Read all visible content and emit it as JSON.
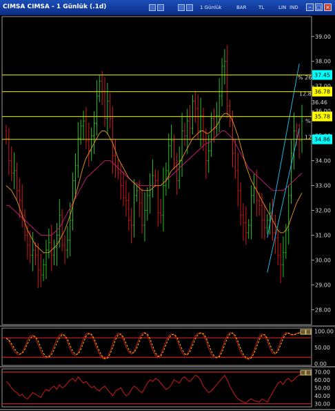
{
  "window": {
    "title": "CIMSA CIMSA - 1 Günlük (.1d)",
    "toolbar_words": [
      "1 Günlük",
      "BAR",
      "TL",
      "LIN",
      "IND"
    ]
  },
  "colors": {
    "background": "#000000",
    "up_bar": "#22c322",
    "down_bar": "#d11a1a",
    "ma_fast": "#d98a1e",
    "ma_slow": "#c21a73",
    "horizontal_level": "#c8c800",
    "trend_channel": "#1fb7e6",
    "oscillator_line": "#d01818",
    "oscillator_signal": "#f2c200",
    "oscillator_band": "#cc2222"
  },
  "chart_data": [
    {
      "type": "candlestick",
      "title": "",
      "ylim": [
        27.4,
        39.8
      ],
      "y_ticks": [
        "39.00",
        "38.00",
        "37.00",
        "36.00",
        "35.00",
        "34.00",
        "33.00",
        "32.00",
        "31.00",
        "30.00",
        "29.00",
        "28.00"
      ],
      "horizontal_levels": [
        {
          "value": 37.45,
          "label": "37.45",
          "label_bg": "#00ffff"
        },
        {
          "value": 36.78,
          "label": "36.78",
          "label_bg": "#ffff00"
        },
        {
          "value": 35.78,
          "label": "35.78",
          "label_bg": "#ffff00"
        },
        {
          "value": 34.86,
          "label": "34.86",
          "label_bg": "#00ffff"
        }
      ],
      "background_labels": [
        "% 26",
        "12.8",
        "36.46",
        "%",
        "12"
      ],
      "series": [
        {
          "name": "",
          "kind": "close",
          "values": [
            34.9,
            34.0,
            33.5,
            33.6,
            32.8,
            32.4,
            31.8,
            31.0,
            30.6,
            30.2,
            30.4,
            30.2,
            29.6,
            29.4,
            29.8,
            30.4,
            30.7,
            30.2,
            30.5,
            31.0,
            31.8,
            30.6,
            30.4,
            30.8,
            31.6,
            33.2,
            33.8,
            34.9,
            35.4,
            35.6,
            34.8,
            34.4,
            35.0,
            35.5,
            36.6,
            37.2,
            36.8,
            35.7,
            36.4,
            35.7,
            34.2,
            33.8,
            33.5,
            33.0,
            32.5,
            32.4,
            31.6,
            31.4,
            32.6,
            32.8,
            32.3,
            31.4,
            32.0,
            32.6,
            33.0,
            33.4,
            33.2,
            31.9,
            31.8,
            33.0,
            33.6,
            34.6,
            34.8,
            33.9,
            33.2,
            34.0,
            35.2,
            35.0,
            35.6,
            35.3,
            36.4,
            36.1,
            35.2,
            35.8,
            34.8,
            34.0,
            34.4,
            35.7,
            35.3,
            35.8,
            36.6,
            37.8,
            38.0,
            36.2,
            35.6,
            34.3,
            33.6,
            32.8,
            31.8,
            31.5,
            31.1,
            31.4,
            32.6,
            32.9,
            32.4,
            32.2,
            31.6,
            31.3,
            31.6,
            31.9,
            31.1,
            30.9,
            30.2,
            29.8,
            30.3,
            31.2,
            32.6,
            34.3,
            35.2,
            35.0,
            34.8,
            35.6
          ]
        },
        {
          "name": "",
          "kind": "moving_average_fast",
          "values": [
            33.0,
            32.9,
            32.8,
            32.6,
            32.4,
            32.1,
            31.8,
            31.5,
            31.2,
            31.0,
            30.8,
            30.6,
            30.5,
            30.4,
            30.3,
            30.3,
            30.3,
            30.4,
            30.5,
            30.6,
            30.8,
            31.0,
            31.2,
            31.5,
            31.8,
            32.2,
            32.6,
            33.0,
            33.4,
            33.8,
            34.1,
            34.3,
            34.5,
            34.7,
            34.9,
            35.1,
            35.2,
            35.2,
            35.1,
            34.9,
            34.7,
            34.4,
            34.1,
            33.9,
            33.7,
            33.5,
            33.3,
            33.2,
            33.1,
            33.0,
            32.9,
            32.8,
            32.8,
            32.8,
            32.8,
            32.9,
            33.0,
            33.0,
            33.0,
            33.1,
            33.2,
            33.4,
            33.6,
            33.7,
            33.8,
            33.9,
            34.1,
            34.3,
            34.5,
            34.7,
            34.9,
            35.0,
            35.1,
            35.2,
            35.2,
            35.1,
            35.1,
            35.2,
            35.3,
            35.4,
            35.6,
            35.8,
            35.9,
            35.9,
            35.8,
            35.6,
            35.3,
            35.0,
            34.6,
            34.2,
            33.8,
            33.5,
            33.2,
            33.0,
            32.8,
            32.6,
            32.4,
            32.2,
            32.0,
            31.8,
            31.6,
            31.4,
            31.2,
            31.1,
            31.1,
            31.2,
            31.4,
            31.7,
            32.0,
            32.3,
            32.5,
            32.7
          ]
        },
        {
          "name": "",
          "kind": "moving_average_slow",
          "values": [
            32.2,
            32.2,
            32.1,
            32.0,
            31.9,
            31.8,
            31.7,
            31.6,
            31.5,
            31.4,
            31.3,
            31.2,
            31.1,
            31.0,
            31.0,
            31.0,
            31.0,
            31.0,
            31.1,
            31.2,
            31.3,
            31.5,
            31.7,
            31.9,
            32.1,
            32.3,
            32.5,
            32.7,
            32.9,
            33.1,
            33.3,
            33.4,
            33.5,
            33.6,
            33.7,
            33.8,
            33.9,
            34.0,
            34.0,
            34.0,
            33.9,
            33.8,
            33.7,
            33.6,
            33.5,
            33.4,
            33.3,
            33.2,
            33.1,
            33.1,
            33.0,
            33.0,
            33.0,
            33.0,
            33.0,
            33.0,
            33.0,
            33.0,
            33.0,
            33.1,
            33.2,
            33.3,
            33.4,
            33.5,
            33.6,
            33.7,
            33.8,
            33.9,
            34.0,
            34.1,
            34.2,
            34.3,
            34.4,
            34.5,
            34.6,
            34.7,
            34.7,
            34.8,
            34.9,
            35.0,
            35.1,
            35.2,
            35.2,
            35.1,
            35.0,
            34.9,
            34.7,
            34.5,
            34.3,
            34.1,
            33.9,
            33.7,
            33.6,
            33.5,
            33.4,
            33.3,
            33.2,
            33.1,
            33.0,
            32.9,
            32.8,
            32.8,
            32.8,
            32.8,
            32.8,
            32.9,
            33.0,
            33.1,
            33.2,
            33.3,
            33.4,
            33.5
          ]
        }
      ],
      "trend_channel": {
        "from_bar": 98,
        "to_bar": 110,
        "lower_start": 29.5,
        "upper_start": 30.9,
        "lower_end": 35.3,
        "upper_end": 37.9
      }
    },
    {
      "type": "line",
      "title": "",
      "ylim": [
        -5,
        110
      ],
      "y_ticks": [
        "100.00",
        "50.00",
        "0.00"
      ],
      "band_levels": [
        80,
        20
      ],
      "series": [
        {
          "name": "",
          "kind": "oscillator",
          "values": [
            82,
            70,
            55,
            40,
            30,
            28,
            35,
            52,
            72,
            86,
            88,
            80,
            60,
            38,
            24,
            18,
            22,
            35,
            55,
            75,
            88,
            92,
            85,
            68,
            45,
            30,
            26,
            34,
            54,
            78,
            92,
            95,
            88,
            70,
            48,
            30,
            18,
            14,
            20,
            38,
            62,
            84,
            94,
            90,
            74,
            52,
            36,
            30,
            38,
            58,
            80,
            94,
            96,
            88,
            66,
            42,
            26,
            20,
            28,
            48,
            70,
            86,
            92,
            90,
            76,
            54,
            36,
            26,
            30,
            46,
            68,
            86,
            94,
            96,
            90,
            72,
            48,
            30,
            20,
            18,
            26,
            46,
            70,
            88,
            96,
            94,
            80,
            58,
            36,
            22,
            16,
            14,
            22,
            40,
            64,
            84,
            92,
            88,
            70,
            48,
            32,
            30,
            46,
            70,
            88,
            96,
            94,
            88,
            90,
            94,
            96,
            97
          ]
        },
        {
          "name": "",
          "kind": "signal",
          "values": [
            78,
            74,
            62,
            48,
            36,
            30,
            32,
            44,
            62,
            78,
            86,
            84,
            70,
            50,
            32,
            22,
            21,
            28,
            44,
            64,
            80,
            90,
            88,
            76,
            56,
            38,
            29,
            30,
            44,
            66,
            85,
            93,
            91,
            78,
            58,
            38,
            24,
            16,
            17,
            30,
            50,
            74,
            89,
            92,
            82,
            63,
            44,
            33,
            34,
            48,
            69,
            87,
            95,
            92,
            77,
            54,
            34,
            23,
            24,
            38,
            59,
            78,
            89,
            91,
            83,
            65,
            45,
            31,
            28,
            38,
            57,
            77,
            90,
            95,
            93,
            81,
            60,
            39,
            25,
            19,
            22,
            36,
            58,
            79,
            92,
            95,
            87,
            69,
            47,
            29,
            19,
            15,
            18,
            31,
            52,
            74,
            88,
            90,
            79,
            59,
            40,
            31,
            38,
            58,
            79,
            92,
            95,
            91,
            89,
            92,
            95,
            96
          ]
        }
      ]
    },
    {
      "type": "line",
      "title": "",
      "ylim": [
        26,
        74
      ],
      "y_ticks": [
        "70.00",
        "60.00",
        "50.00",
        "40.00",
        "30.00"
      ],
      "band_levels": [
        70,
        30
      ],
      "series": [
        {
          "name": "",
          "kind": "rsi",
          "values": [
            58,
            55,
            50,
            46,
            44,
            40,
            42,
            38,
            36,
            40,
            44,
            42,
            40,
            38,
            44,
            48,
            46,
            50,
            52,
            48,
            54,
            50,
            52,
            56,
            60,
            62,
            58,
            64,
            60,
            56,
            58,
            54,
            50,
            52,
            48,
            46,
            50,
            52,
            48,
            44,
            40,
            46,
            48,
            50,
            44,
            40,
            42,
            48,
            52,
            50,
            46,
            44,
            50,
            56,
            60,
            58,
            62,
            60,
            56,
            52,
            48,
            50,
            54,
            60,
            58,
            56,
            62,
            64,
            60,
            58,
            62,
            66,
            64,
            60,
            52,
            48,
            44,
            46,
            50,
            54,
            58,
            62,
            66,
            60,
            52,
            46,
            40,
            36,
            34,
            32,
            31,
            34,
            36,
            34,
            33,
            32,
            36,
            34,
            32,
            38,
            44,
            50,
            56,
            58,
            54,
            60,
            62,
            58,
            60,
            64,
            66,
            68
          ]
        }
      ]
    }
  ]
}
